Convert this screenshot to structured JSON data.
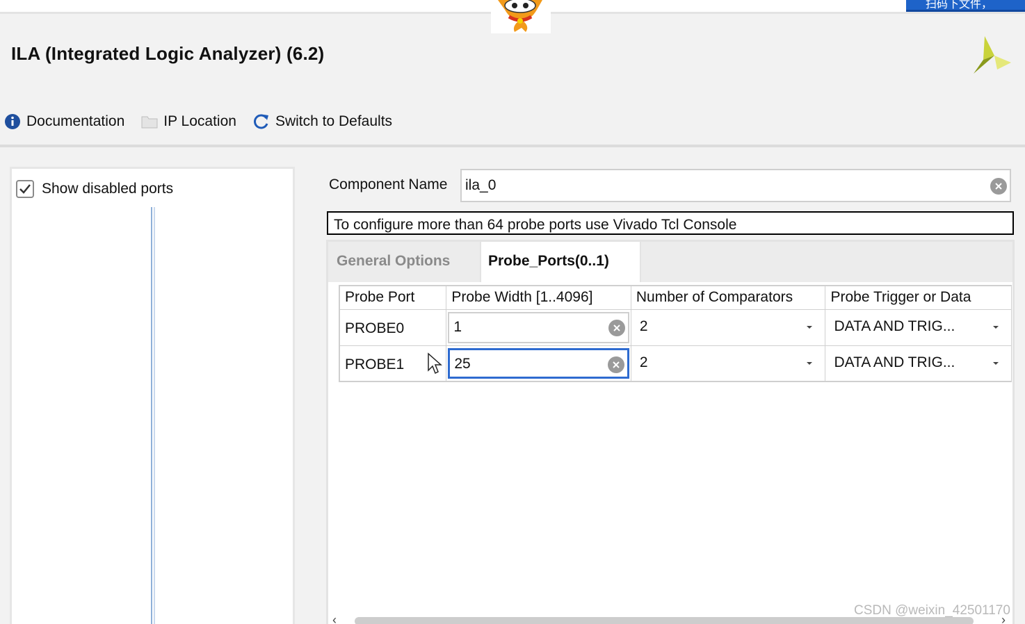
{
  "window": {
    "title": "ILA (Integrated Logic Analyzer) (6.2)",
    "corner_banner": "扫码下文件，"
  },
  "toolbar": {
    "documentation": "Documentation",
    "ip_location": "IP Location",
    "switch_defaults": "Switch to Defaults"
  },
  "left_panel": {
    "show_disabled_ports": "Show disabled ports",
    "show_disabled_checked": true
  },
  "component": {
    "label": "Component Name",
    "value": "ila_0"
  },
  "notice": "To configure more than 64 probe ports use Vivado Tcl Console",
  "tabs": [
    {
      "label": "General Options",
      "active": false
    },
    {
      "label": "Probe_Ports(0..1)",
      "active": true
    }
  ],
  "table": {
    "headers": [
      "Probe Port",
      "Probe Width [1..4096]",
      "Number of Comparators",
      "Probe Trigger or Data"
    ],
    "rows": [
      {
        "port": "PROBE0",
        "width": "1",
        "comparators": "2",
        "trigger": "DATA AND TRIG..."
      },
      {
        "port": "PROBE1",
        "width": "25",
        "comparators": "2",
        "trigger": "DATA AND TRIG..."
      }
    ]
  },
  "watermark": "CSDN @weixin_42501170",
  "colors": {
    "focus_blue": "#2e6bd0",
    "info_icon_blue": "#1f4f9e",
    "xilinx_logo": "#b5c62c"
  }
}
